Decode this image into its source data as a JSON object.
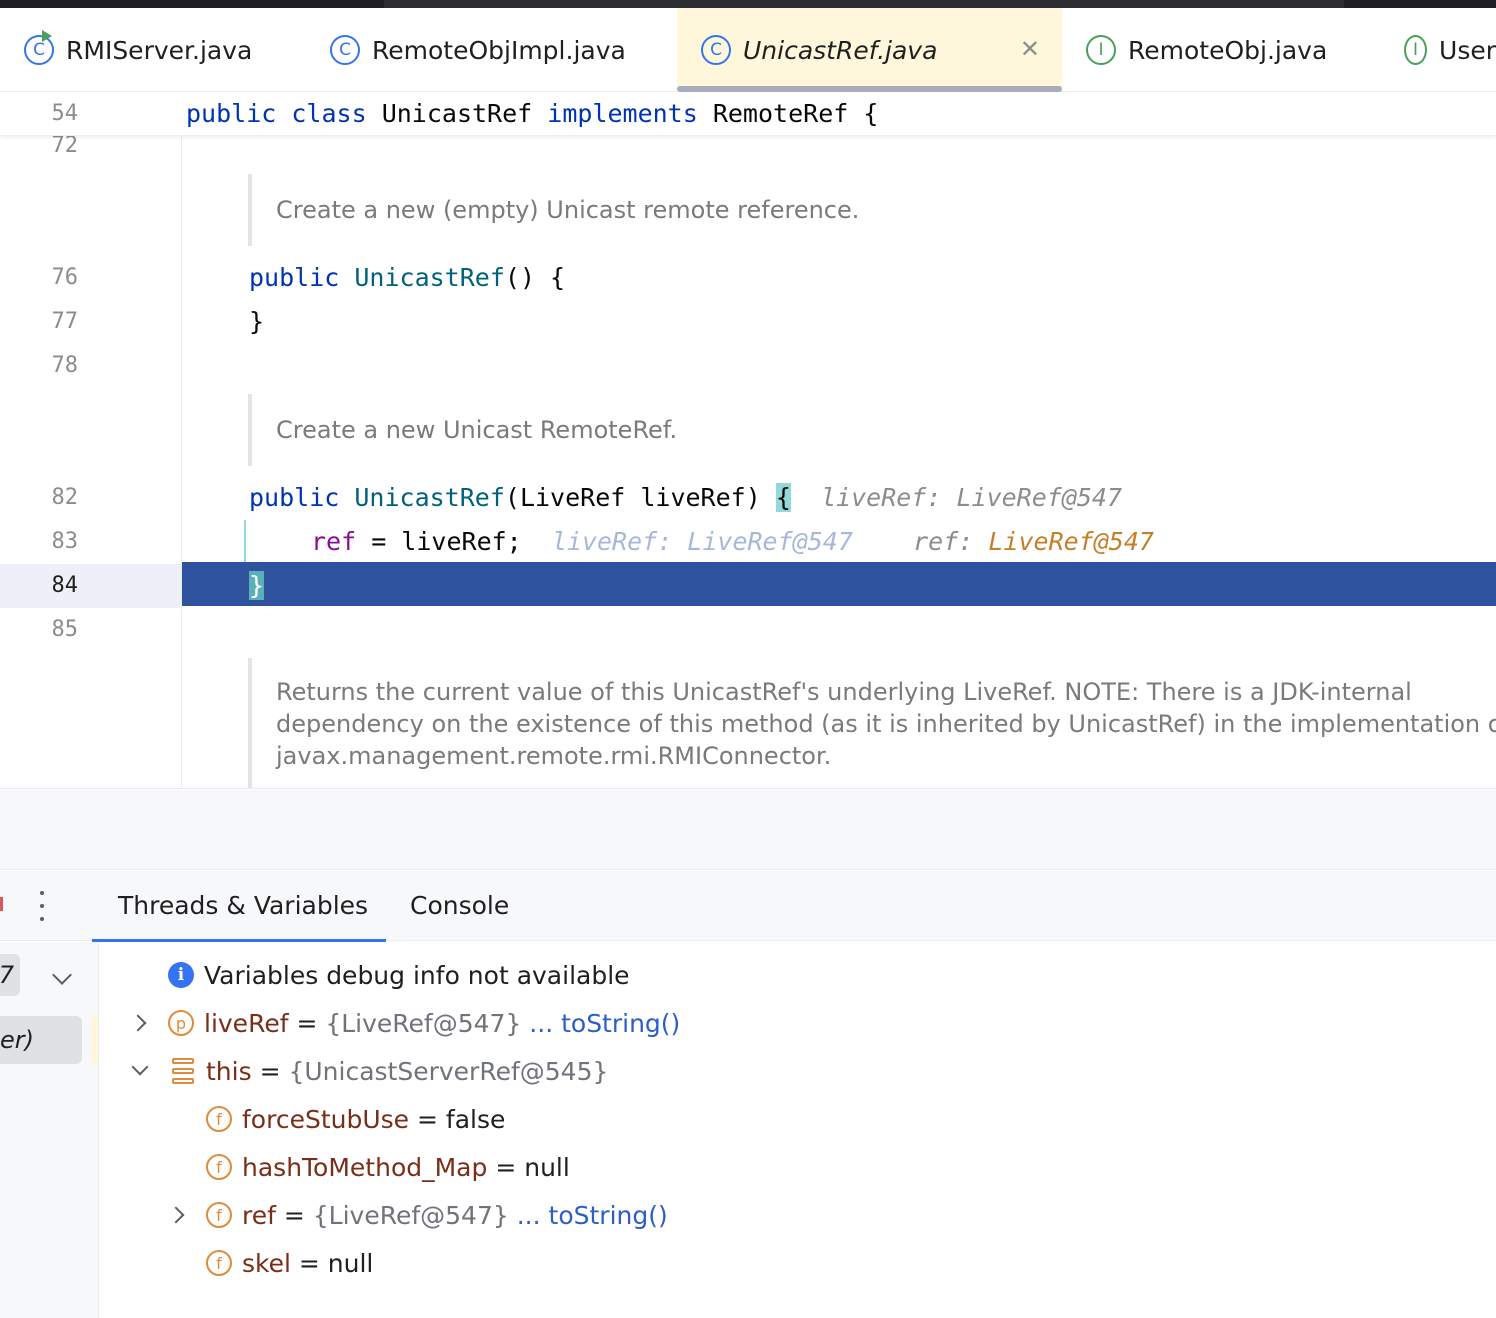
{
  "tabs": [
    {
      "label": "RMIServer.java",
      "icon": "class-runnable-icon"
    },
    {
      "label": "RemoteObjImpl.java",
      "icon": "class-icon"
    },
    {
      "label": "UnicastRef.java",
      "icon": "class-icon",
      "active": true
    },
    {
      "label": "RemoteObj.java",
      "icon": "interface-icon"
    },
    {
      "label": "User",
      "icon": "interface-icon"
    }
  ],
  "editor": {
    "sticky": {
      "line": "54",
      "kw1": "public",
      "kw2": "class",
      "name": " UnicastRef ",
      "kw3": "implements",
      "rest": " RemoteRef {"
    },
    "ln72": "72",
    "doc1": "Create a new (empty) Unicast remote reference.",
    "ln76": "76",
    "l76": {
      "kw": "public",
      "fn": "UnicastRef",
      "rest": "() {"
    },
    "ln77": "77",
    "l77": "}",
    "ln78": "78",
    "doc2": "Create a new Unicast RemoteRef.",
    "ln82": "82",
    "l82": {
      "kw": "public",
      "fn": "UnicastRef",
      "params": "(LiveRef liveRef) ",
      "brace": "{",
      "hint_name": "liveRef: ",
      "hint_val": "LiveRef@547"
    },
    "ln83": "83",
    "l83": {
      "field": "ref",
      "rest": " = liveRef;",
      "hint1": "liveRef: LiveRef@547",
      "hint2_name": "ref: ",
      "hint2_val": "LiveRef@547"
    },
    "ln84": "84",
    "l84": "}",
    "ln85": "85",
    "doc3_l1": "Returns the current value of this UnicastRef's underlying LiveRef. NOTE: There is a JDK-internal",
    "doc3_l2": "dependency on the existence of this method (as it is inherited by UnicastRef) in the implementation o",
    "doc3_l3": "javax.management.remote.rmi.RMIConnector."
  },
  "debug": {
    "tabs": [
      "Threads & Variables",
      "Console"
    ],
    "frame_dropdown": "7",
    "frame_item": "er)",
    "info": "Variables debug info not available",
    "vars": [
      {
        "name": "liveRef",
        "eq": " = ",
        "val": "{LiveRef@547}",
        "link": " ... toString()"
      },
      {
        "name": "this",
        "eq": " = ",
        "val": "{UnicastServerRef@545}"
      },
      {
        "name": "forceStubUse",
        "eq": " = ",
        "plain": "false"
      },
      {
        "name": "hashToMethod_Map",
        "eq": " = ",
        "plain": "null"
      },
      {
        "name": "ref",
        "eq": " = ",
        "val": "{LiveRef@547}",
        "link": " ... toString()"
      },
      {
        "name": "skel",
        "eq": " = ",
        "plain": "null"
      }
    ],
    "icons": {
      "param": "p",
      "field": "f",
      "info": "i"
    }
  },
  "colors": {
    "accent": "#3574f0",
    "exec_line": "#2f539e",
    "active_tab": "#fef7dc"
  }
}
